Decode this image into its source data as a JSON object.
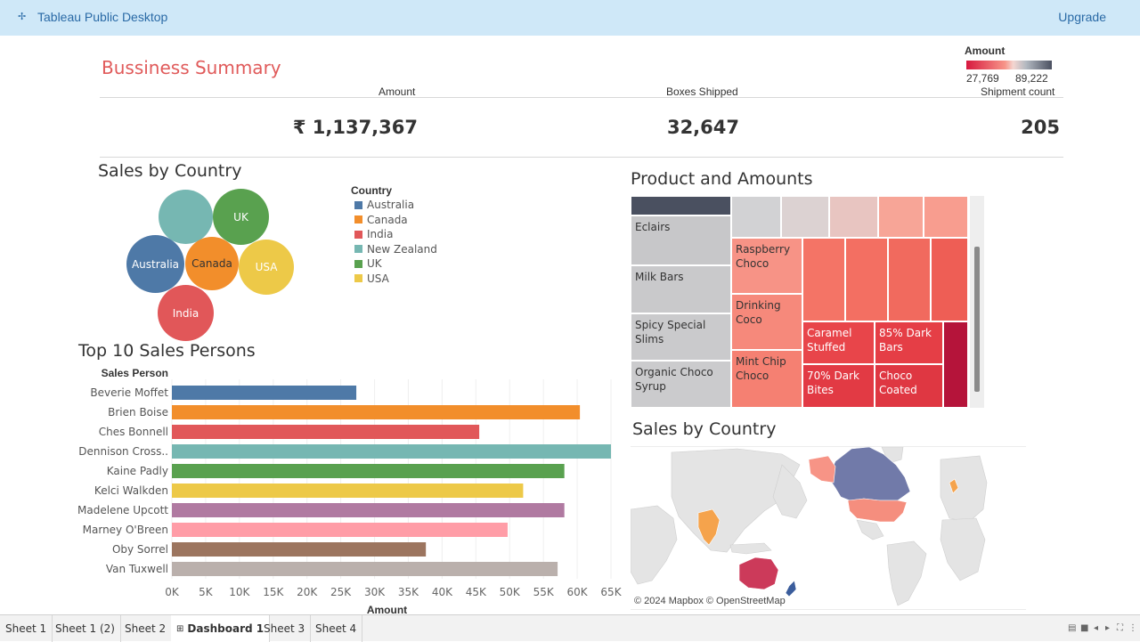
{
  "app": {
    "title": "Tableau Public Desktop",
    "upgrade_label": "Upgrade"
  },
  "summary": {
    "title": "Bussiness Summary",
    "kpis": [
      {
        "label": "Amount",
        "value": "₹ 1,137,367"
      },
      {
        "label": "Boxes Shipped",
        "value": "32,647"
      },
      {
        "label": "Shipment count",
        "value": "205"
      }
    ]
  },
  "amount_legend": {
    "title": "Amount",
    "min": "27,769",
    "max": "89,222"
  },
  "bubble_chart": {
    "title": "Sales by Country",
    "legend_title": "Country",
    "countries": [
      {
        "name": "Australia",
        "color": "#4e79a7"
      },
      {
        "name": "Canada",
        "color": "#f28e2b"
      },
      {
        "name": "India",
        "color": "#e15759"
      },
      {
        "name": "New Zealand",
        "color": "#76b7b2"
      },
      {
        "name": "UK",
        "color": "#59a14f"
      },
      {
        "name": "USA",
        "color": "#edc948"
      }
    ],
    "bubble_labels": {
      "uk": "UK",
      "australia": "Australia",
      "canada": "Canada",
      "usa": "USA",
      "india": "India"
    }
  },
  "chart_data": {
    "type": "bar",
    "title": "Top 10 Sales Persons",
    "ylabel": "Sales Person",
    "xlabel": "Amount",
    "xlim": [
      0,
      65000
    ],
    "ticks": [
      "0K",
      "5K",
      "10K",
      "15K",
      "20K",
      "25K",
      "30K",
      "35K",
      "40K",
      "45K",
      "50K",
      "55K",
      "60K",
      "65K"
    ],
    "categories": [
      "Beverie Moffet",
      "Brien Boise",
      "Ches Bonnell",
      "Dennison Cross..",
      "Kaine Padly",
      "Kelci Walkden",
      "Madelene Upcott",
      "Marney O'Breen",
      "Oby Sorrel",
      "Van Tuxwell"
    ],
    "values": [
      27300,
      60400,
      45500,
      65000,
      58100,
      52000,
      58100,
      49700,
      37600,
      57100
    ],
    "colors": [
      "#4e79a7",
      "#f28e2b",
      "#e15759",
      "#76b7b2",
      "#59a14f",
      "#edc948",
      "#b07aa1",
      "#ff9da7",
      "#9c755f",
      "#bab0ac"
    ]
  },
  "treemap": {
    "title": "Product and Amounts",
    "labels": {
      "eclairs": "Eclairs",
      "milk_bars": "Milk Bars",
      "spicy": "Spicy Special Slims",
      "organic": "Organic Choco Syrup",
      "raspberry": "Raspberry Choco",
      "drinking": "Drinking Coco",
      "mint": "Mint Chip Choco",
      "caramel": "Caramel Stuffed",
      "dark85": "85% Dark Bars",
      "dark70": "70% Dark Bites",
      "coated": "Choco Coated"
    }
  },
  "map": {
    "title": "Sales by Country",
    "attribution": "© 2024 Mapbox © OpenStreetMap"
  },
  "tabs": [
    {
      "label": "Sheet 1",
      "active": false
    },
    {
      "label": "Sheet 1 (2)",
      "active": false
    },
    {
      "label": "Sheet 2",
      "active": false
    },
    {
      "label": "Dashboard 1",
      "active": true
    },
    {
      "label": "Sheet 3",
      "active": false
    },
    {
      "label": "Sheet 4",
      "active": false
    }
  ]
}
